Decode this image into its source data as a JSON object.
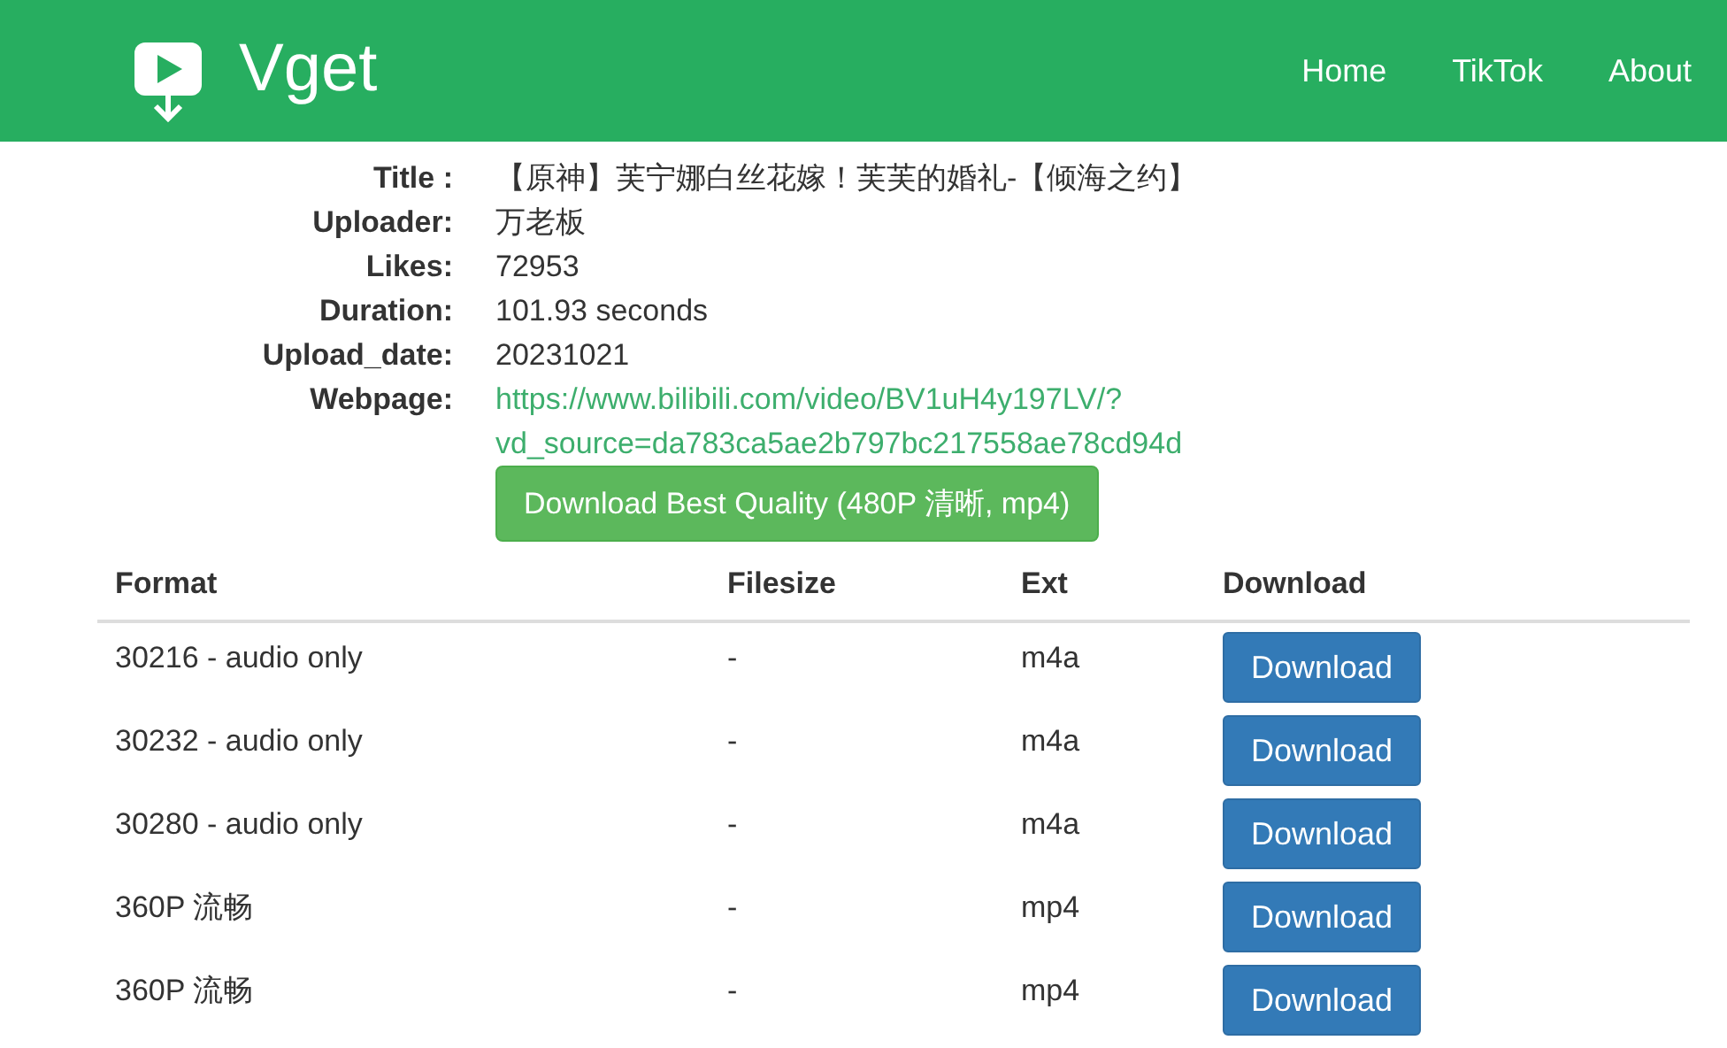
{
  "header": {
    "brand": "Vget",
    "nav": [
      {
        "label": "Home"
      },
      {
        "label": "TikTok"
      },
      {
        "label": "About"
      }
    ]
  },
  "info": [
    {
      "label": "Title :",
      "value": "【原神】芙宁娜白丝花嫁！芙芙的婚礼-【倾海之约】",
      "kind": "text"
    },
    {
      "label": "Uploader:",
      "value": "万老板",
      "kind": "text"
    },
    {
      "label": "Likes:",
      "value": "72953",
      "kind": "text"
    },
    {
      "label": "Duration:",
      "value": "101.93 seconds",
      "kind": "text"
    },
    {
      "label": "Upload_date:",
      "value": "20231021",
      "kind": "text"
    },
    {
      "label": "Webpage:",
      "value": "https://www.bilibili.com/video/BV1uH4y197LV/?vd_source=da783ca5ae2b797bc217558ae78cd94d",
      "kind": "link"
    }
  ],
  "best_button": "Download Best Quality (480P 清晰, mp4)",
  "table": {
    "columns": [
      "Format",
      "Filesize",
      "Ext",
      "Download"
    ],
    "rows": [
      {
        "format": "30216 - audio only",
        "filesize": "-",
        "ext": "m4a",
        "action": "Download"
      },
      {
        "format": "30232 - audio only",
        "filesize": "-",
        "ext": "m4a",
        "action": "Download"
      },
      {
        "format": "30280 - audio only",
        "filesize": "-",
        "ext": "m4a",
        "action": "Download"
      },
      {
        "format": "360P 流畅",
        "filesize": "-",
        "ext": "mp4",
        "action": "Download"
      },
      {
        "format": "360P 流畅",
        "filesize": "-",
        "ext": "mp4",
        "action": "Download"
      }
    ]
  }
}
